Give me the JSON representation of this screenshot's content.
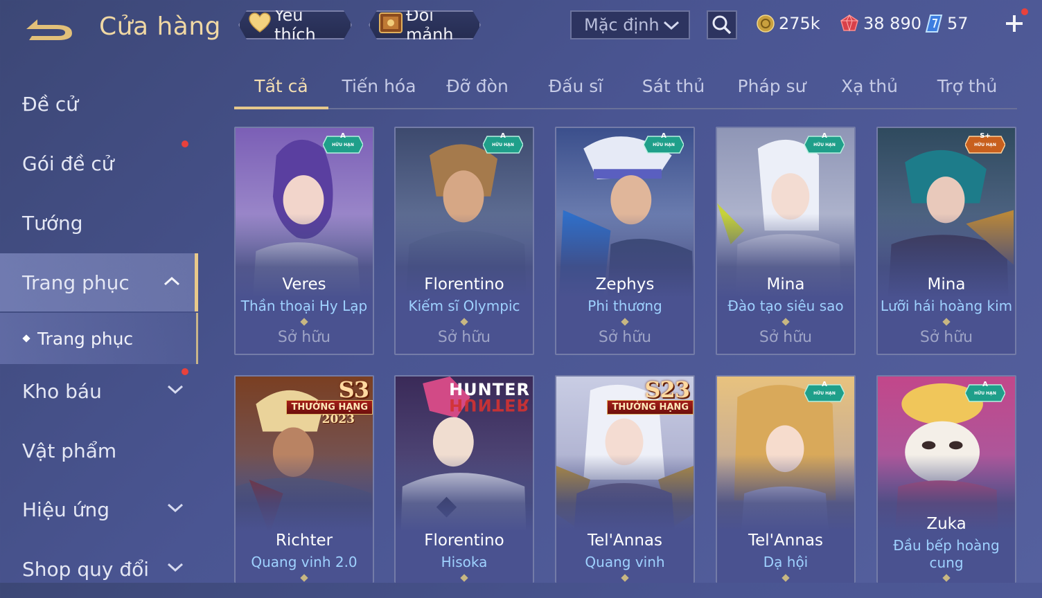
{
  "header": {
    "title": "Cửa hàng",
    "favorite_label": "Yêu thích",
    "shard_label": "Đổi mảnh",
    "sort_value": "Mặc định",
    "currencies": {
      "gold": "275k",
      "ruby": "38 890",
      "voucher": "57"
    }
  },
  "sidebar": {
    "items": [
      {
        "label": "Đề cử"
      },
      {
        "label": "Gói đề cử"
      },
      {
        "label": "Tướng"
      },
      {
        "label": "Trang phục"
      },
      {
        "label": "Trang phục"
      },
      {
        "label": "Kho báu"
      },
      {
        "label": "Vật phẩm"
      },
      {
        "label": "Hiệu ứng"
      },
      {
        "label": "Shop quy đổi"
      }
    ]
  },
  "tabs": [
    "Tất cả",
    "Tiến hóa",
    "Đỡ đòn",
    "Đấu sĩ",
    "Sát thủ",
    "Pháp sư",
    "Xạ thủ",
    "Trợ thủ"
  ],
  "cards": [
    {
      "hero": "Veres",
      "skin": "Thần thoại Hy Lạp",
      "status": "Sở hữu",
      "badge": "A",
      "badge_sub": "HỮU HẠN",
      "badge_color": "#1f9f8a"
    },
    {
      "hero": "Florentino",
      "skin": "Kiếm sĩ Olympic",
      "status": "Sở hữu",
      "badge": "A",
      "badge_sub": "HỮU HẠN",
      "badge_color": "#1f9f8a"
    },
    {
      "hero": "Zephys",
      "skin": "Phi thương",
      "status": "Sở hữu",
      "badge": "A",
      "badge_sub": "HỮU HẠN",
      "badge_color": "#1f9f8a"
    },
    {
      "hero": "Mina",
      "skin": "Đào tạo siêu sao",
      "status": "Sở hữu",
      "badge": "A",
      "badge_sub": "HỮU HẠN",
      "badge_color": "#1f9f8a"
    },
    {
      "hero": "Mina",
      "skin": "Lưỡi hái hoàng kim",
      "status": "Sở hữu",
      "badge": "S+",
      "badge_sub": "HỮU HẠN",
      "badge_color": "#c8601e"
    },
    {
      "hero": "Richter",
      "skin": "Quang vinh 2.0",
      "banner_big": "S3",
      "banner_ribbon": "THƯỞNG HẠNG",
      "banner_year": "2023"
    },
    {
      "hero": "Florentino",
      "skin": "Hisoka",
      "logo_top": "HUNTER",
      "logo_bottom": "HUNTER"
    },
    {
      "hero": "Tel'Annas",
      "skin": "Quang vinh",
      "banner_big": "S23",
      "banner_ribbon": "THƯỞNG HẠNG"
    },
    {
      "hero": "Tel'Annas",
      "skin": "Dạ hội",
      "badge": "A",
      "badge_sub": "HỮU HẠN",
      "badge_color": "#1f9f8a"
    },
    {
      "hero": "Zuka",
      "skin": "Đầu bếp hoàng cung",
      "badge": "A",
      "badge_sub": "HỮU HẠN",
      "badge_color": "#1f9f8a"
    }
  ],
  "icons": {
    "back": "back-arrow-icon",
    "heart": "heart-icon",
    "chest": "chest-icon",
    "search": "search-icon",
    "gold": "gold-coin-icon",
    "ruby": "ruby-gem-icon",
    "voucher": "voucher-crystal-icon",
    "plus": "plus-icon"
  },
  "colors": {
    "accent_gold": "#e6c88c",
    "skin_name": "#9fd2ff",
    "notification": "#e8413c"
  }
}
